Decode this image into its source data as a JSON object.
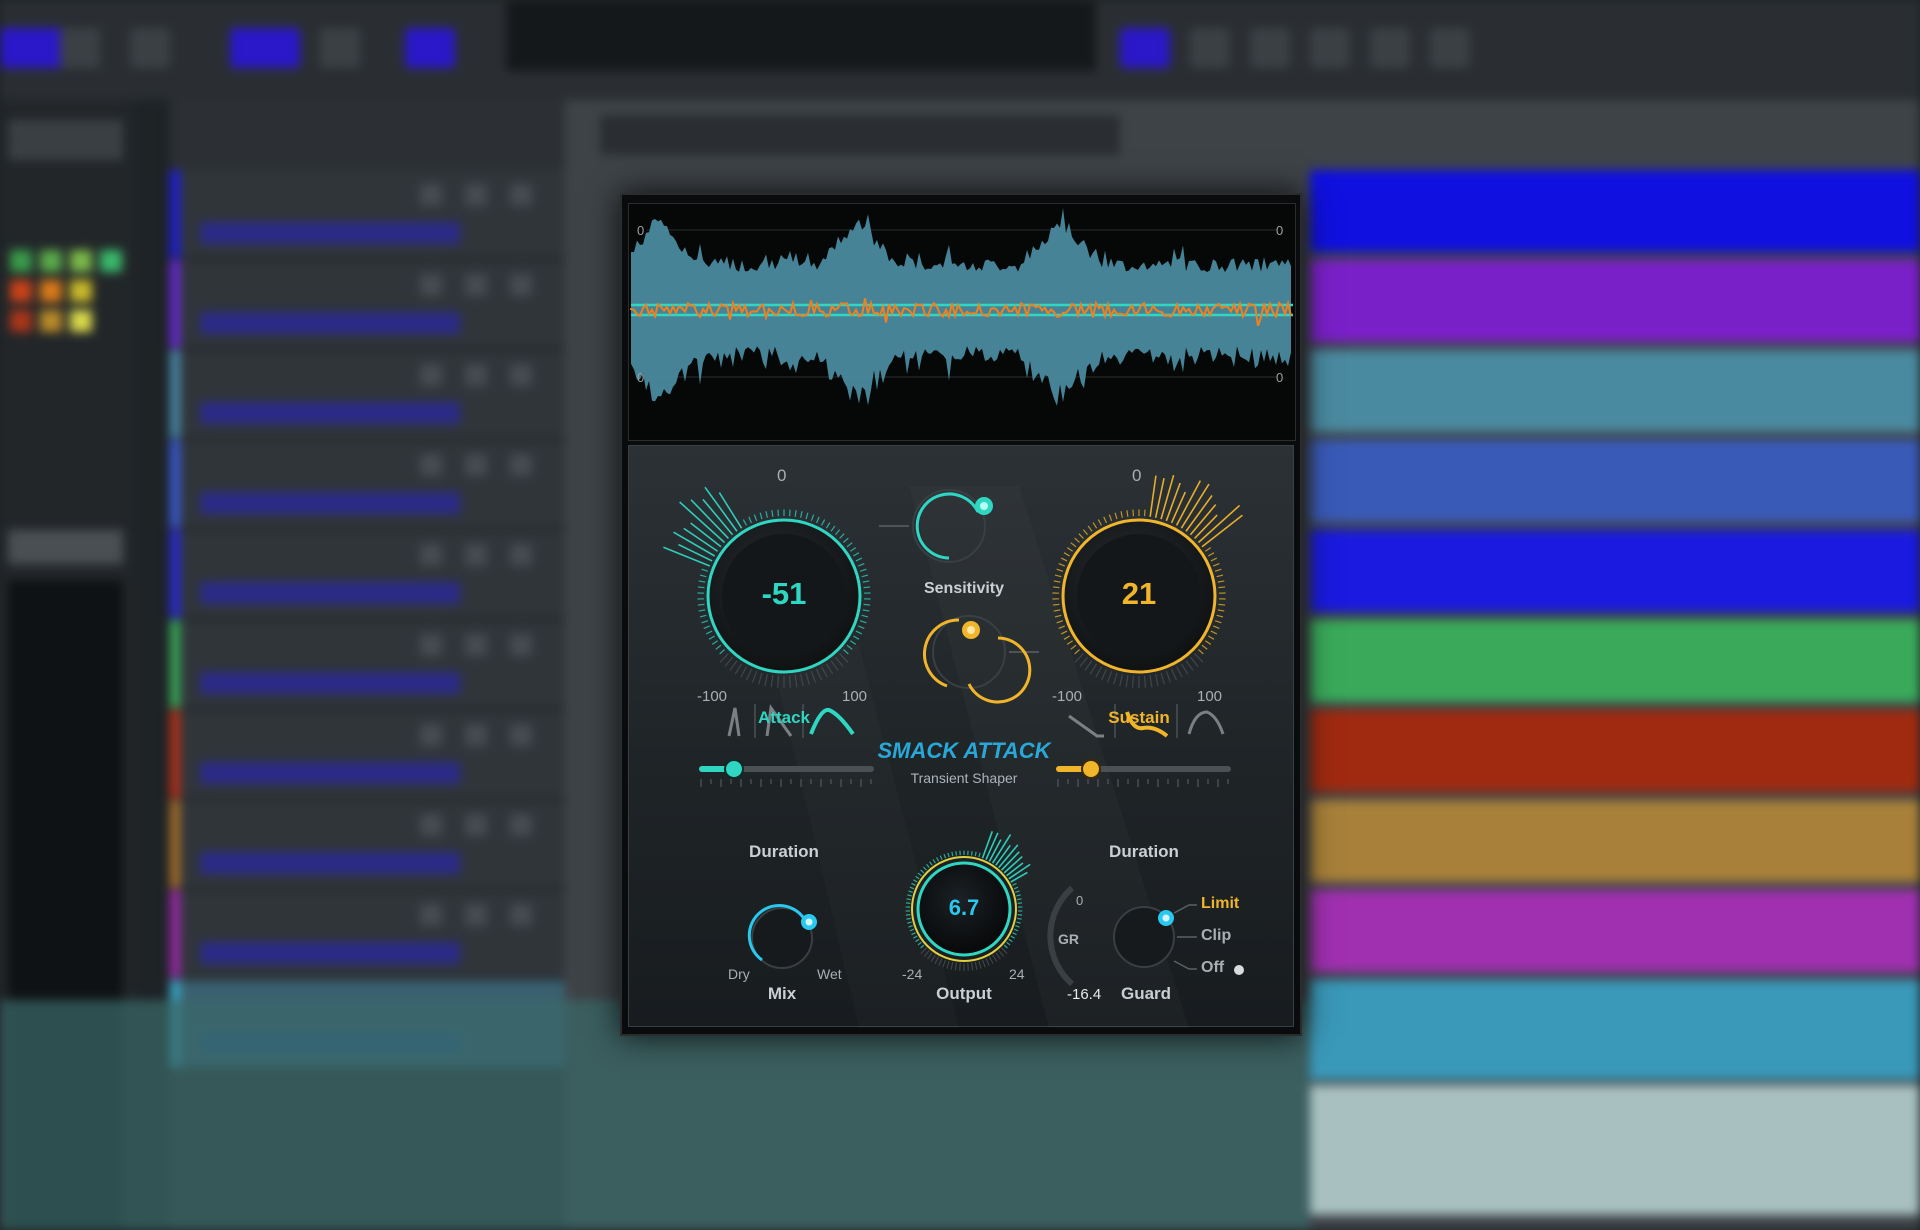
{
  "plugin": {
    "brand": "SMACK ATTACK",
    "subtitle": "Transient Shaper",
    "waveform": {
      "scale_top_left": "0",
      "scale_top_right": "0",
      "scale_bottom_left": "0",
      "scale_bottom_right": "0"
    },
    "attack": {
      "label": "Attack",
      "value": "-51",
      "zero_label": "0",
      "min_label": "-100",
      "max_label": "100",
      "color": "#2fd6c1"
    },
    "sustain": {
      "label": "Sustain",
      "value": "21",
      "zero_label": "0",
      "min_label": "-100",
      "max_label": "100",
      "color": "#f0b52a"
    },
    "sensitivity": {
      "label": "Sensitivity"
    },
    "attack_duration": {
      "label": "Duration",
      "level": 0.2
    },
    "sustain_duration": {
      "label": "Duration",
      "level": 0.2
    },
    "mix": {
      "label": "Mix",
      "min_label": "Dry",
      "max_label": "Wet"
    },
    "output": {
      "label": "Output",
      "value": "6.7",
      "min_label": "-24",
      "max_label": "24"
    },
    "guard": {
      "label": "Guard",
      "gr_label": "GR",
      "gr_zero": "0",
      "gr_value": "-16.4",
      "options": [
        "Limit",
        "Clip",
        "Off"
      ],
      "selected": "Limit"
    }
  },
  "colors": {
    "teal": "#2fd6c1",
    "amber": "#f0b52a",
    "wave_fill": "#4a8a9e",
    "wave_line": "#f08020",
    "cyan_dot": "#29c9ef"
  }
}
